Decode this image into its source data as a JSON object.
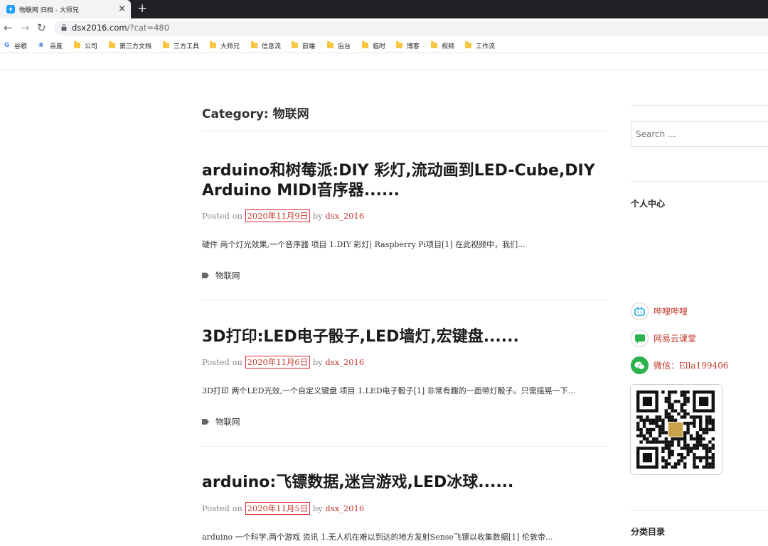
{
  "browser": {
    "tab_title": "物联网 归档 - 大师兄",
    "new_tab_symbol": "+",
    "close_symbol": "×",
    "url_host": "dsx2016.com",
    "url_rest": "/?cat=480"
  },
  "bookmarks": [
    {
      "label": "谷歌",
      "icon": "google-icon"
    },
    {
      "label": "百度",
      "icon": "baidu-icon"
    },
    {
      "label": "公司",
      "icon": "folder-icon"
    },
    {
      "label": "第三方文档",
      "icon": "folder-icon"
    },
    {
      "label": "三方工具",
      "icon": "folder-icon"
    },
    {
      "label": "大师兄",
      "icon": "folder-icon"
    },
    {
      "label": "信息流",
      "icon": "folder-icon"
    },
    {
      "label": "前端",
      "icon": "folder-icon"
    },
    {
      "label": "后台",
      "icon": "folder-icon"
    },
    {
      "label": "临时",
      "icon": "folder-icon"
    },
    {
      "label": "博客",
      "icon": "folder-icon"
    },
    {
      "label": "视频",
      "icon": "folder-icon"
    },
    {
      "label": "工作流",
      "icon": "folder-icon"
    }
  ],
  "page": {
    "category_heading": "Category: 物联网",
    "posted_on": "Posted on",
    "by": "by",
    "posts": [
      {
        "title": "arduino和树莓派:DIY 彩灯,流动画到LED-Cube,DIY Arduino MIDI音序器......",
        "date": "2020年11月9日",
        "author": "dsx_2016",
        "excerpt": "硬件 两个灯光效果,一个音序器 项目 1.DIY 彩灯| Raspberry Pi项目[1] 在此视频中，我们...",
        "category": "物联网"
      },
      {
        "title": "3D打印:LED电子骰子,LED墙灯,宏键盘......",
        "date": "2020年11月6日",
        "author": "dsx_2016",
        "excerpt": "3D打印 两个LED光效,一个自定义键盘 项目 1.LED电子骰子[1] 非常有趣的一面带灯骰子。只需摇晃一下...",
        "category": "物联网"
      },
      {
        "title": "arduino:飞镖数据,迷宫游戏,LED冰球......",
        "date": "2020年11月5日",
        "author": "dsx_2016",
        "excerpt": "arduino 一个科学,两个游戏 资讯 1.无人机在难以到达的地方发射Sense飞镖以收集数据[1] 伦敦帝..."
      }
    ]
  },
  "sidebar": {
    "search_placeholder": "Search ...",
    "personal_center": "个人中心",
    "links": [
      {
        "label": "哔哩哔哩",
        "icon": "bilibili-icon"
      },
      {
        "label": "网易云课堂",
        "icon": "netease-study-icon"
      },
      {
        "label": "微信：Ella199406",
        "icon": "wechat-icon"
      }
    ],
    "category_directory": "分类目录"
  }
}
